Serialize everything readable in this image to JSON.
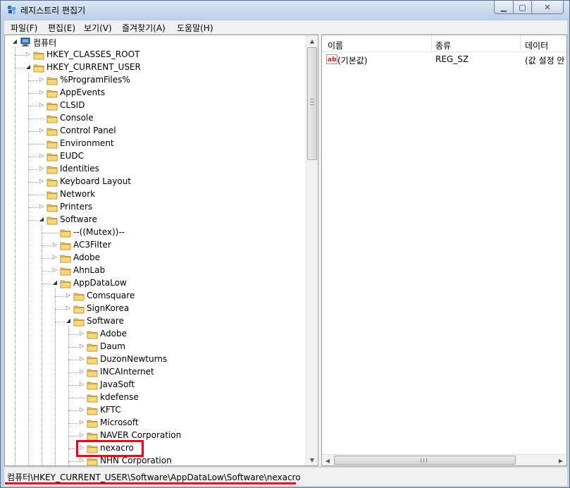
{
  "window": {
    "title": "레지스트리 편집기"
  },
  "menu": [
    "파일(F)",
    "편집(E)",
    "보기(V)",
    "즐겨찾기(A)",
    "도움말(H)"
  ],
  "tree": {
    "nodes": [
      {
        "label": "컴퓨터",
        "depth": 0,
        "state": "open",
        "kind": "computer"
      },
      {
        "label": "HKEY_CLASSES_ROOT",
        "depth": 1,
        "state": "closed"
      },
      {
        "label": "HKEY_CURRENT_USER",
        "depth": 1,
        "state": "open"
      },
      {
        "label": "%ProgramFiles%",
        "depth": 2,
        "state": "closed"
      },
      {
        "label": "AppEvents",
        "depth": 2,
        "state": "closed"
      },
      {
        "label": "CLSID",
        "depth": 2,
        "state": "closed"
      },
      {
        "label": "Console",
        "depth": 2,
        "state": "leaf"
      },
      {
        "label": "Control Panel",
        "depth": 2,
        "state": "closed"
      },
      {
        "label": "Environment",
        "depth": 2,
        "state": "leaf"
      },
      {
        "label": "EUDC",
        "depth": 2,
        "state": "closed"
      },
      {
        "label": "Identities",
        "depth": 2,
        "state": "closed"
      },
      {
        "label": "Keyboard Layout",
        "depth": 2,
        "state": "closed"
      },
      {
        "label": "Network",
        "depth": 2,
        "state": "leaf"
      },
      {
        "label": "Printers",
        "depth": 2,
        "state": "closed"
      },
      {
        "label": "Software",
        "depth": 2,
        "state": "open"
      },
      {
        "label": "--((Mutex))--",
        "depth": 3,
        "state": "leaf"
      },
      {
        "label": "AC3Filter",
        "depth": 3,
        "state": "closed"
      },
      {
        "label": "Adobe",
        "depth": 3,
        "state": "closed"
      },
      {
        "label": "AhnLab",
        "depth": 3,
        "state": "closed"
      },
      {
        "label": "AppDataLow",
        "depth": 3,
        "state": "open"
      },
      {
        "label": "Comsquare",
        "depth": 4,
        "state": "closed"
      },
      {
        "label": "SignKorea",
        "depth": 4,
        "state": "closed"
      },
      {
        "label": "Software",
        "depth": 4,
        "state": "open"
      },
      {
        "label": "Adobe",
        "depth": 5,
        "state": "closed"
      },
      {
        "label": "Daum",
        "depth": 5,
        "state": "closed"
      },
      {
        "label": "DuzonNewturns",
        "depth": 5,
        "state": "closed"
      },
      {
        "label": "INCAInternet",
        "depth": 5,
        "state": "closed"
      },
      {
        "label": "JavaSoft",
        "depth": 5,
        "state": "closed"
      },
      {
        "label": "kdefense",
        "depth": 5,
        "state": "leaf"
      },
      {
        "label": "KFTC",
        "depth": 5,
        "state": "closed"
      },
      {
        "label": "Microsoft",
        "depth": 5,
        "state": "closed"
      },
      {
        "label": "NAVER Corporation",
        "depth": 5,
        "state": "closed"
      },
      {
        "label": "nexacro",
        "depth": 5,
        "state": "closed",
        "highlighted": true
      },
      {
        "label": "NHN Corporation",
        "depth": 5,
        "state": "closed"
      }
    ]
  },
  "list": {
    "columns": [
      "이름",
      "종류",
      "데이터"
    ],
    "rows": [
      {
        "name": "(기본값)",
        "type": "REG_SZ",
        "data": "(값 설정 안"
      }
    ]
  },
  "status": {
    "path": "컴퓨터\\HKEY_CURRENT_USER\\Software\\AppDataLow\\Software\\nexacro"
  },
  "colors": {
    "highlight": "#e3001b",
    "folder": "#e8c15a"
  }
}
